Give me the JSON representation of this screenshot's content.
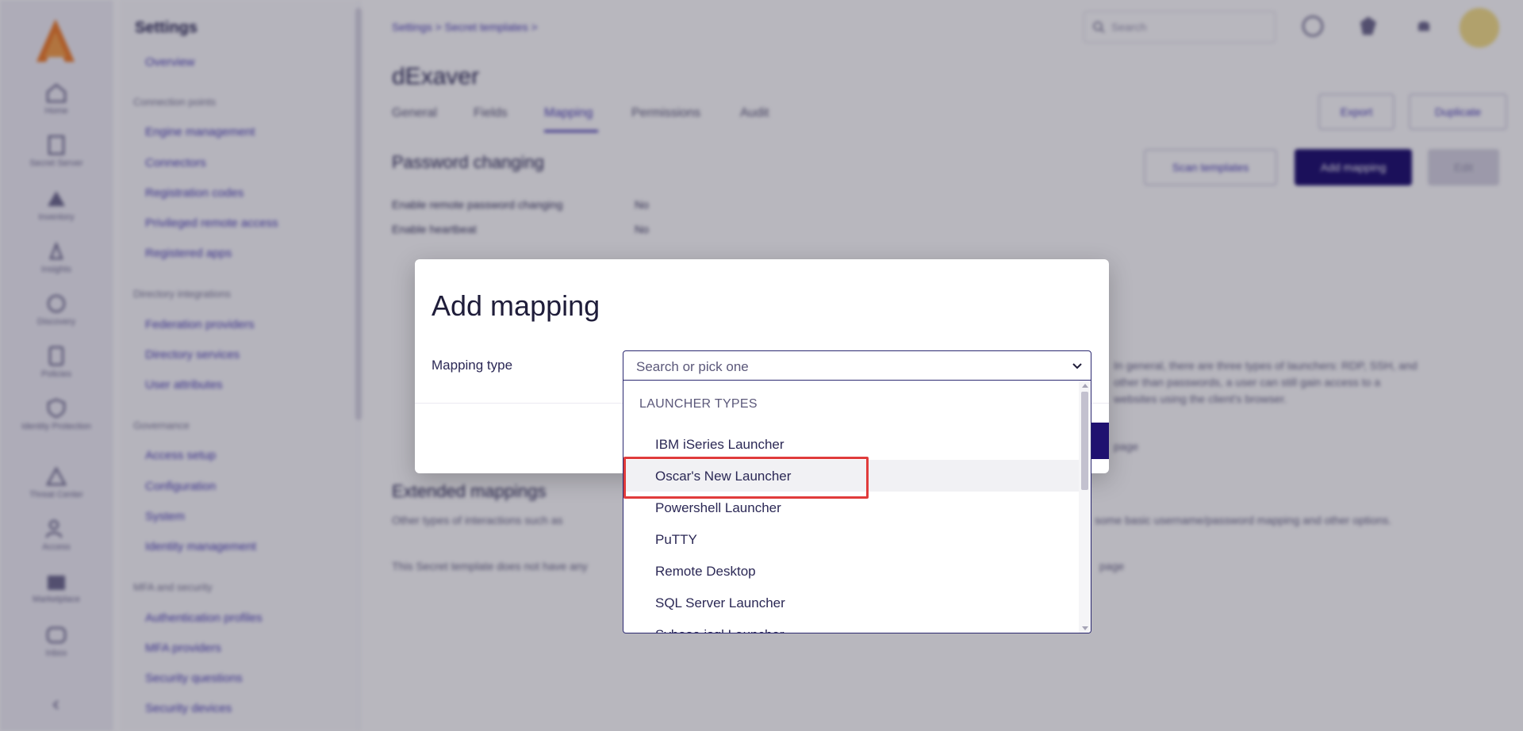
{
  "rail": {
    "items": [
      {
        "label": "Home",
        "icon": "home-icon"
      },
      {
        "label": "Secret Server",
        "icon": "secret-server-icon"
      },
      {
        "label": "Inventory",
        "icon": "inventory-icon"
      },
      {
        "label": "Insights",
        "icon": "insights-icon"
      },
      {
        "label": "Discovery",
        "icon": "discovery-icon"
      },
      {
        "label": "Policies",
        "icon": "policies-icon"
      },
      {
        "label": "Identity Protection",
        "icon": "identity-icon"
      },
      {
        "label": "Threat Center",
        "icon": "threat-icon"
      },
      {
        "label": "Access",
        "icon": "access-icon"
      },
      {
        "label": "Marketplace",
        "icon": "marketplace-icon"
      },
      {
        "label": "Inbox",
        "icon": "inbox-icon"
      }
    ]
  },
  "settings_nav": {
    "title": "Settings",
    "overview": "Overview",
    "groups": [
      {
        "name": "Connection points",
        "links": [
          "Engine management",
          "Connectors",
          "Registration codes",
          "Privileged remote access",
          "Registered apps"
        ]
      },
      {
        "name": "Directory integrations",
        "links": [
          "Federation providers",
          "Directory services",
          "User attributes"
        ]
      },
      {
        "name": "Governance",
        "links": [
          "Access setup",
          "Configuration",
          "System",
          "Identity management"
        ]
      },
      {
        "name": "MFA and security",
        "links": [
          "Authentication profiles",
          "MFA providers",
          "Security questions",
          "Security devices"
        ]
      }
    ]
  },
  "header": {
    "breadcrumb": "Settings  >  Secret templates  >",
    "search_placeholder": "Search"
  },
  "page": {
    "title": "dExaver",
    "tabs": [
      "General",
      "Fields",
      "Mapping",
      "Permissions",
      "Audit"
    ],
    "active_tab": "Mapping",
    "export_label": "Export",
    "duplicate_label": "Duplicate",
    "scan_templates_label": "Scan templates",
    "add_mapping_label": "Add mapping",
    "edit_label": "Edit",
    "password_changing_title": "Password changing",
    "kv": [
      {
        "key": "Enable remote password changing",
        "value": "No"
      },
      {
        "key": "Enable heartbeat",
        "value": "No"
      }
    ],
    "extended_title": "Extended mappings",
    "text_launchers": "In general, there are three types of launchers: RDP, SSH, and",
    "text_launchers_2": "other than passwords, a user can still gain access to a",
    "text_launchers_3": "websites using the client's browser.",
    "text_extended": "Other types of interactions such as",
    "text_extended_2": "some basic username/password mapping and other options.",
    "text_none": "This Secret template does not have any",
    "text_page": "page"
  },
  "modal": {
    "title": "Add mapping",
    "field_label": "Mapping type",
    "combo_placeholder": "Search or pick one",
    "group_label": "LAUNCHER TYPES",
    "options": [
      "IBM iSeries Launcher",
      "Oscar's New Launcher",
      "Powershell Launcher",
      "PuTTY",
      "Remote Desktop",
      "SQL Server Launcher",
      "Sybase isql Launcher"
    ],
    "hovered_option": "Oscar's New Launcher"
  },
  "colors": {
    "primary": "#1f1170",
    "link": "#4b3fb5",
    "highlight": "#e03b3b"
  }
}
